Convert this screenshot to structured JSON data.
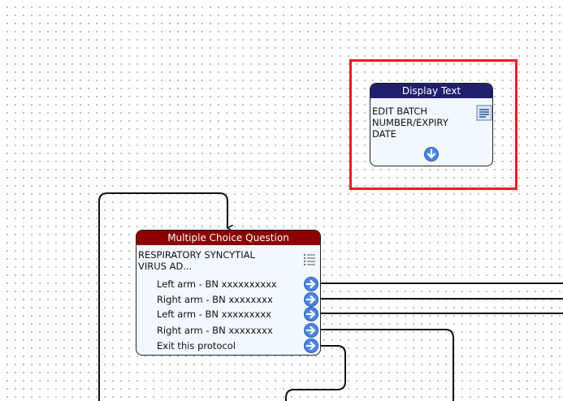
{
  "canvas": {
    "display_text_node": {
      "title": "Display Text",
      "text": "EDIT BATCH\nNUMBER/EXPIRY\nDATE",
      "icon": "text-document-icon",
      "header_color": "#1f1f6e",
      "selected": true,
      "selection_color": "#e02020"
    },
    "multiple_choice_node": {
      "title": "Multiple Choice Question",
      "text": "RESPIRATORY SYNCYTIAL\nVIRUS AD...",
      "icon": "list-icon",
      "header_color": "#8b0000",
      "options": [
        {
          "label": "Left arm - BN xxxxxxxxxx"
        },
        {
          "label": "Right arm - BN xxxxxxxx"
        },
        {
          "label": "Left arm - BN xxxxxxxxx"
        },
        {
          "label": "Right arm - BN xxxxxxxx"
        },
        {
          "label": "Exit this protocol"
        }
      ]
    }
  }
}
